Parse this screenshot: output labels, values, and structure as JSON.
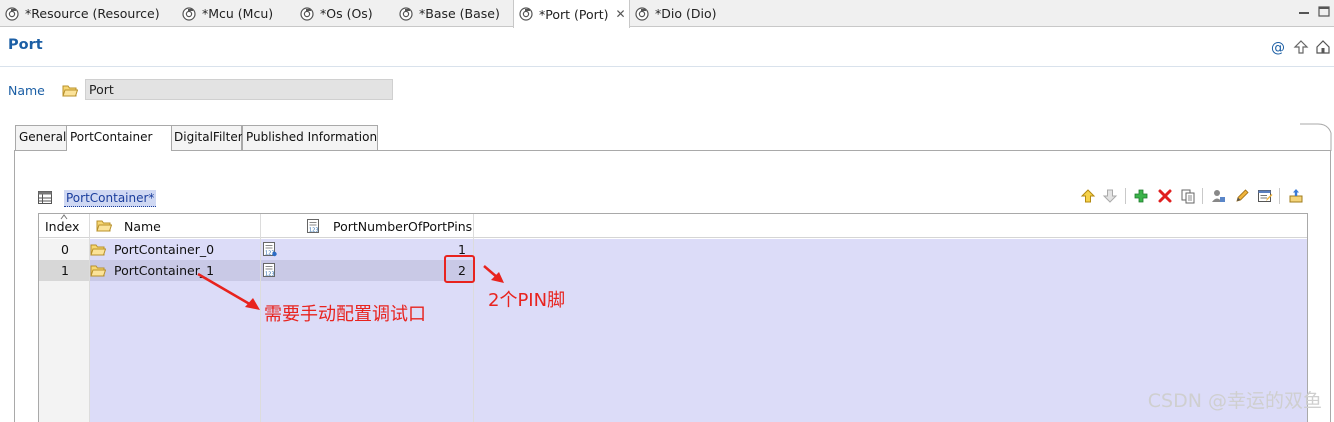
{
  "editor_tabs": [
    {
      "label": "*Resource (Resource)",
      "active": false
    },
    {
      "label": "*Mcu (Mcu)",
      "active": false
    },
    {
      "label": "*Os (Os)",
      "active": false
    },
    {
      "label": "*Base (Base)",
      "active": false
    },
    {
      "label": "*Port (Port)",
      "active": true
    },
    {
      "label": "*Dio (Dio)",
      "active": false
    }
  ],
  "header": {
    "title": "Port"
  },
  "name_row": {
    "label": "Name",
    "value": "Port"
  },
  "page_tabs": [
    "General",
    "PortContainer",
    "DigitalFilter",
    "Published Information"
  ],
  "table": {
    "title": "PortContainer*",
    "columns": [
      "Index",
      "Name",
      "PortNumberOfPortPins"
    ],
    "rows": [
      {
        "index": "0",
        "name": "PortContainer_0",
        "pins": "1"
      },
      {
        "index": "1",
        "name": "PortContainer_1",
        "pins": "2"
      }
    ]
  },
  "annotations": {
    "manual_note": "需要手动配置调试口",
    "pin_note": "2个PIN脚",
    "color": "#e8231e"
  },
  "watermark": "CSDN @幸运的双鱼",
  "colors": {
    "accent": "#1c5fa5",
    "row_bg": "#dcdcf8",
    "selection": "#cfd8f3"
  }
}
